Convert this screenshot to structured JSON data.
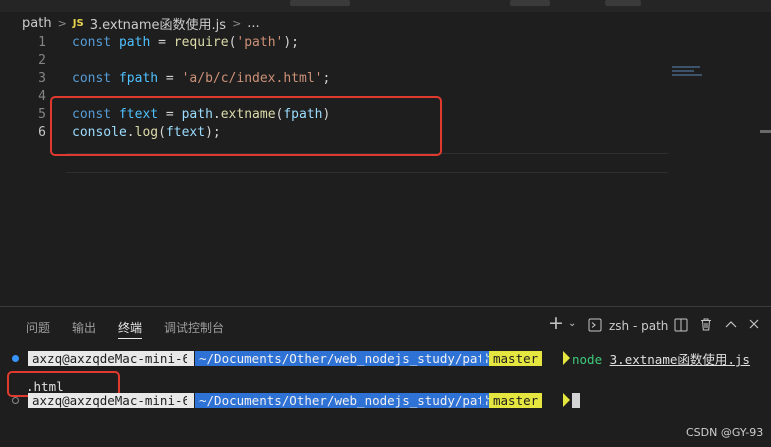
{
  "breadcrumb": {
    "folder": "path",
    "file_badge": "JS",
    "file": "3.extname函数使用.js",
    "more": "..."
  },
  "editor": {
    "lines": [
      {
        "num": "1",
        "tokens": [
          [
            "kw",
            "const "
          ],
          [
            "var",
            "path"
          ],
          [
            "pun",
            " = "
          ],
          [
            "fn",
            "require"
          ],
          [
            "pun",
            "("
          ],
          [
            "str",
            "'path'"
          ],
          [
            "pun",
            ");"
          ]
        ]
      },
      {
        "num": "2",
        "tokens": []
      },
      {
        "num": "3",
        "tokens": [
          [
            "kw",
            "const "
          ],
          [
            "var",
            "fpath"
          ],
          [
            "pun",
            " = "
          ],
          [
            "str",
            "'a/b/c/index.html'"
          ],
          [
            "pun",
            ";"
          ]
        ]
      },
      {
        "num": "4",
        "tokens": []
      },
      {
        "num": "5",
        "tokens": [
          [
            "kw",
            "const "
          ],
          [
            "var",
            "ftext"
          ],
          [
            "pun",
            " = "
          ],
          [
            "obj",
            "path"
          ],
          [
            "pun",
            "."
          ],
          [
            "fn",
            "extname"
          ],
          [
            "pun",
            "("
          ],
          [
            "obj",
            "fpath"
          ],
          [
            "pun",
            ")"
          ]
        ]
      },
      {
        "num": "6",
        "tokens": [
          [
            "obj",
            "console"
          ],
          [
            "pun",
            "."
          ],
          [
            "fn",
            "log"
          ],
          [
            "pun",
            "("
          ],
          [
            "obj",
            "ftext"
          ],
          [
            "pun",
            ");"
          ]
        ]
      }
    ]
  },
  "panel": {
    "tabs": [
      "问题",
      "输出",
      "终端",
      "调试控制台"
    ],
    "active_tab": "终端",
    "terminal_label": "zsh - path"
  },
  "terminal": {
    "user": "axzq@axzqdeMac-mini-6",
    "path": "~/Documents/Other/web_nodejs_study/path",
    "branch_icon": "",
    "branch": "master",
    "command": "node",
    "command_arg": "3.extname函数使用.js",
    "output": ".html"
  },
  "watermark": "CSDN @GY-93",
  "colors": {
    "highlight": "#e03a2f",
    "path_segment": "#2f72d6",
    "branch_segment": "#e6e640"
  }
}
